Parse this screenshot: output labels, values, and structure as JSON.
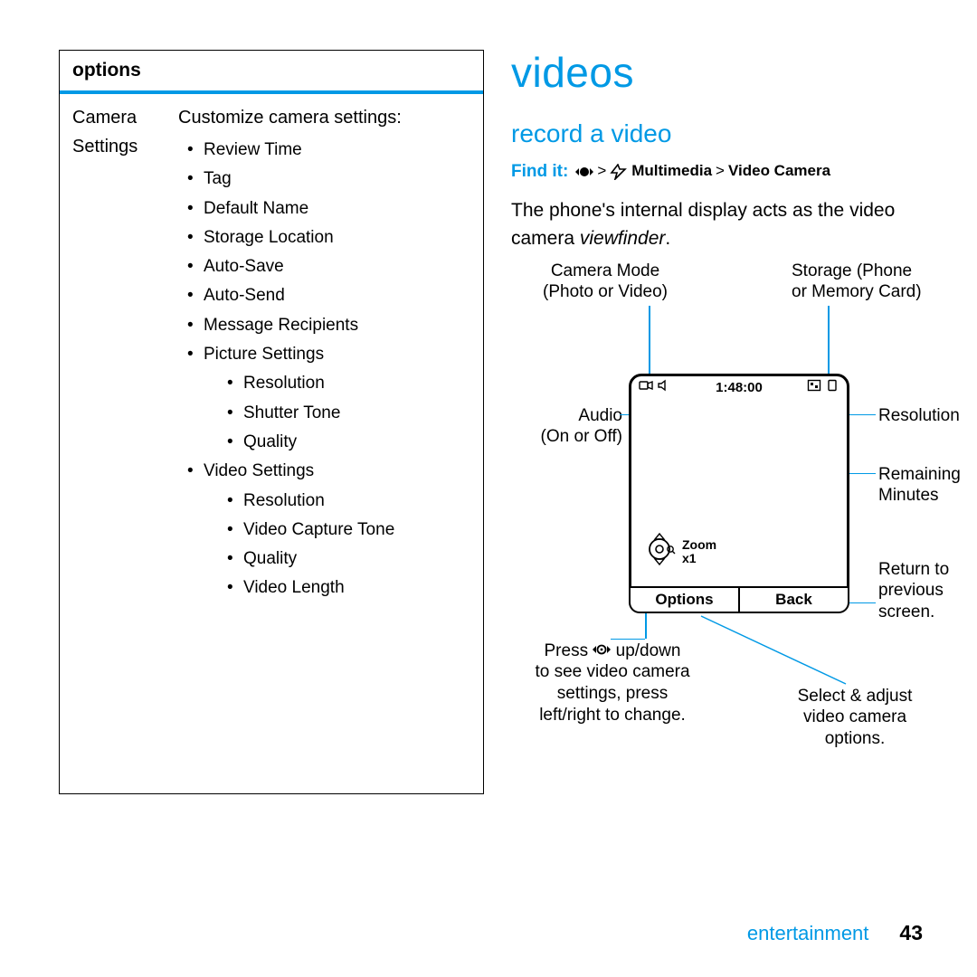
{
  "left": {
    "header": "options",
    "row_label_1": "Camera",
    "row_label_2": "Settings",
    "intro": "Customize camera settings:",
    "items": [
      "Review Time",
      "Tag",
      "Default Name",
      "Storage Location",
      "Auto-Save",
      "Auto-Send",
      "Message Recipients"
    ],
    "picture_group": "Picture Settings",
    "picture_items": [
      "Resolution",
      "Shutter Tone",
      "Quality"
    ],
    "video_group": "Video Settings",
    "video_items": [
      "Resolution",
      "Video Capture Tone",
      "Quality",
      "Video Length"
    ]
  },
  "right": {
    "h1": "videos",
    "h2": "record a video",
    "findit_label": "Find it:",
    "findit_sep": ">",
    "findit_multimedia": "Multimedia",
    "findit_videocam": "Video Camera",
    "desc_1": "The phone's internal display acts as the video",
    "desc_2a": "camera ",
    "desc_2b": "viewfinder",
    "desc_2c": "."
  },
  "diagram": {
    "callouts": {
      "camera_mode_1": "Camera Mode",
      "camera_mode_2": "(Photo or Video)",
      "storage_1": "Storage (Phone",
      "storage_2": "or Memory Card)",
      "audio_1": "Audio",
      "audio_2": "(On or Off)",
      "resolution": "Resolution",
      "remaining_1": "Remaining",
      "remaining_2": "Minutes",
      "return_1": "Return to",
      "return_2": "previous",
      "return_3": "screen.",
      "navhint_1": "Press",
      "navhint_2": "up/down",
      "navhint_3": "to see video camera",
      "navhint_4": "settings, press",
      "navhint_5": "left/right to change.",
      "select_1": "Select & adjust",
      "select_2": "video camera",
      "select_3": "options."
    },
    "statusbar_time": "1:48:00",
    "zoom_1": "Zoom",
    "zoom_2": "x1",
    "softkey_left": "Options",
    "softkey_right": "Back"
  },
  "footer": {
    "section": "entertainment",
    "page": "43"
  }
}
